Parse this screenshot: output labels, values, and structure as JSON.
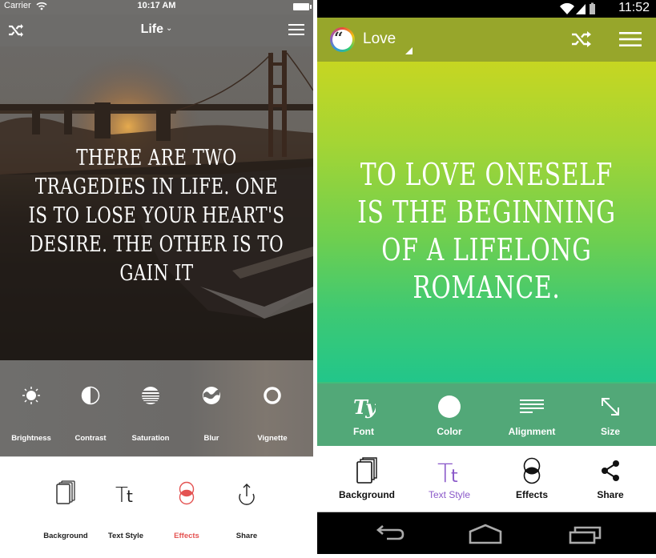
{
  "ios": {
    "status": {
      "carrier": "Carrier",
      "time": "10:17 AM"
    },
    "nav": {
      "title": "Life",
      "title_chevron": "⌄",
      "shuffle_icon": "shuffle-icon",
      "menu_icon": "hamburger-menu-icon"
    },
    "quote": "There are two tragedies in life. One is to lose your heart's desire. The other is to gain it",
    "effects": [
      {
        "label": "Brightness",
        "icon": "sun-icon"
      },
      {
        "label": "Contrast",
        "icon": "contrast-icon"
      },
      {
        "label": "Saturation",
        "icon": "saturation-icon"
      },
      {
        "label": "Blur",
        "icon": "blur-icon"
      },
      {
        "label": "Vignette",
        "icon": "ring-icon"
      }
    ],
    "tabs": [
      {
        "label": "Background",
        "icon": "stacked-pages-icon",
        "active": false
      },
      {
        "label": "Text Style",
        "icon": "text-style-icon",
        "active": false
      },
      {
        "label": "Effects",
        "icon": "effects-icon",
        "active": true
      },
      {
        "label": "Share",
        "icon": "share-upload-icon",
        "active": false
      }
    ],
    "active_color": "#e45352"
  },
  "android": {
    "status": {
      "time": "11:52"
    },
    "appbar": {
      "title": "Love",
      "logo_icon": "quote-logo-icon",
      "shuffle_icon": "shuffle-icon",
      "menu_icon": "hamburger-menu-icon",
      "color": "#97a62b"
    },
    "quote": "To love oneself is the beginning of a lifelong romance.",
    "gradient": {
      "top": "#c6d622",
      "bottom": "#22c68a"
    },
    "tools": [
      {
        "label": "Font",
        "icon": "font-script-icon",
        "glyph": "Ty"
      },
      {
        "label": "Color",
        "icon": "color-circle-icon"
      },
      {
        "label": "Alignment",
        "icon": "align-lines-icon"
      },
      {
        "label": "Size",
        "icon": "resize-arrow-icon"
      }
    ],
    "tabs": [
      {
        "label": "Background",
        "icon": "stacked-pages-icon",
        "active": false
      },
      {
        "label": "Text Style",
        "icon": "text-style-icon",
        "active": true
      },
      {
        "label": "Effects",
        "icon": "effects-icon",
        "active": false
      },
      {
        "label": "Share",
        "icon": "share-nodes-icon",
        "active": false
      }
    ],
    "active_color": "#8a58c9",
    "navbar": [
      "back",
      "home",
      "recents"
    ]
  }
}
